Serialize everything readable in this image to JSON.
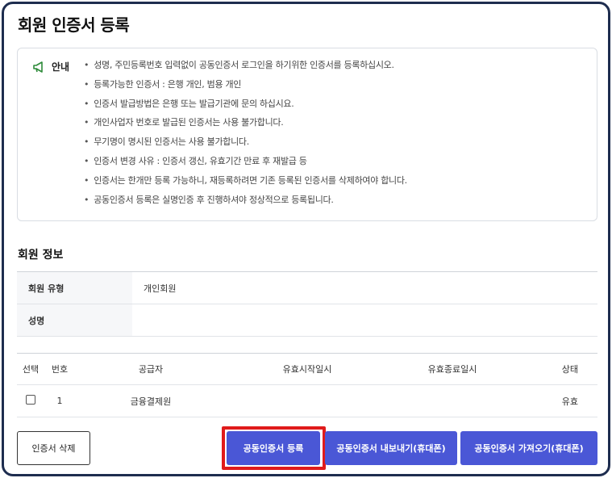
{
  "page": {
    "title": "회원 인증서 등록"
  },
  "notice": {
    "label": "안내",
    "icon": "megaphone-icon",
    "items": [
      "성명, 주민등록번호 입력없이 공동인증서 로그인을 하기위한 인증서를 등록하십시오.",
      "등록가능한 인증서 : 은행 개인, 범용 개인",
      "인증서 발급방법은 은행 또는 발급기관에 문의 하십시요.",
      "개인사업자 번호로 발급된 인증서는 사용 불가합니다.",
      "무기명이 명시된 인증서는 사용 불가합니다.",
      "인증서 변경 사유 : 인증서 갱신, 유효기간 만료 후 재발급 등",
      "인증서는 한개만 등록 가능하니, 재등록하려면 기존 등록된 인증서를 삭제하여야 합니다.",
      "공동인증서 등록은 실명인증 후 진행하셔야 정상적으로 등록됩니다."
    ]
  },
  "member": {
    "section_title": "회원 정보",
    "rows": [
      {
        "label": "회원 유형",
        "value": "개인회원"
      },
      {
        "label": "성명",
        "value": ""
      }
    ]
  },
  "certs": {
    "headers": [
      "선택",
      "번호",
      "공급자",
      "유효시작일시",
      "유효종료일시",
      "상태"
    ],
    "rows": [
      {
        "no": "1",
        "supplier": "금융결제원",
        "start": "",
        "end": "",
        "status": "유효"
      }
    ]
  },
  "buttons": {
    "delete": "인증서 삭제",
    "register": "공동인증서 등록",
    "export": "공동인증서 내보내기(휴대폰)",
    "import": "공동인증서 가져오기(휴대폰)"
  },
  "colors": {
    "primary": "#4a57d6",
    "highlight": "#e01b1b",
    "frame": "#1e2d4f"
  }
}
